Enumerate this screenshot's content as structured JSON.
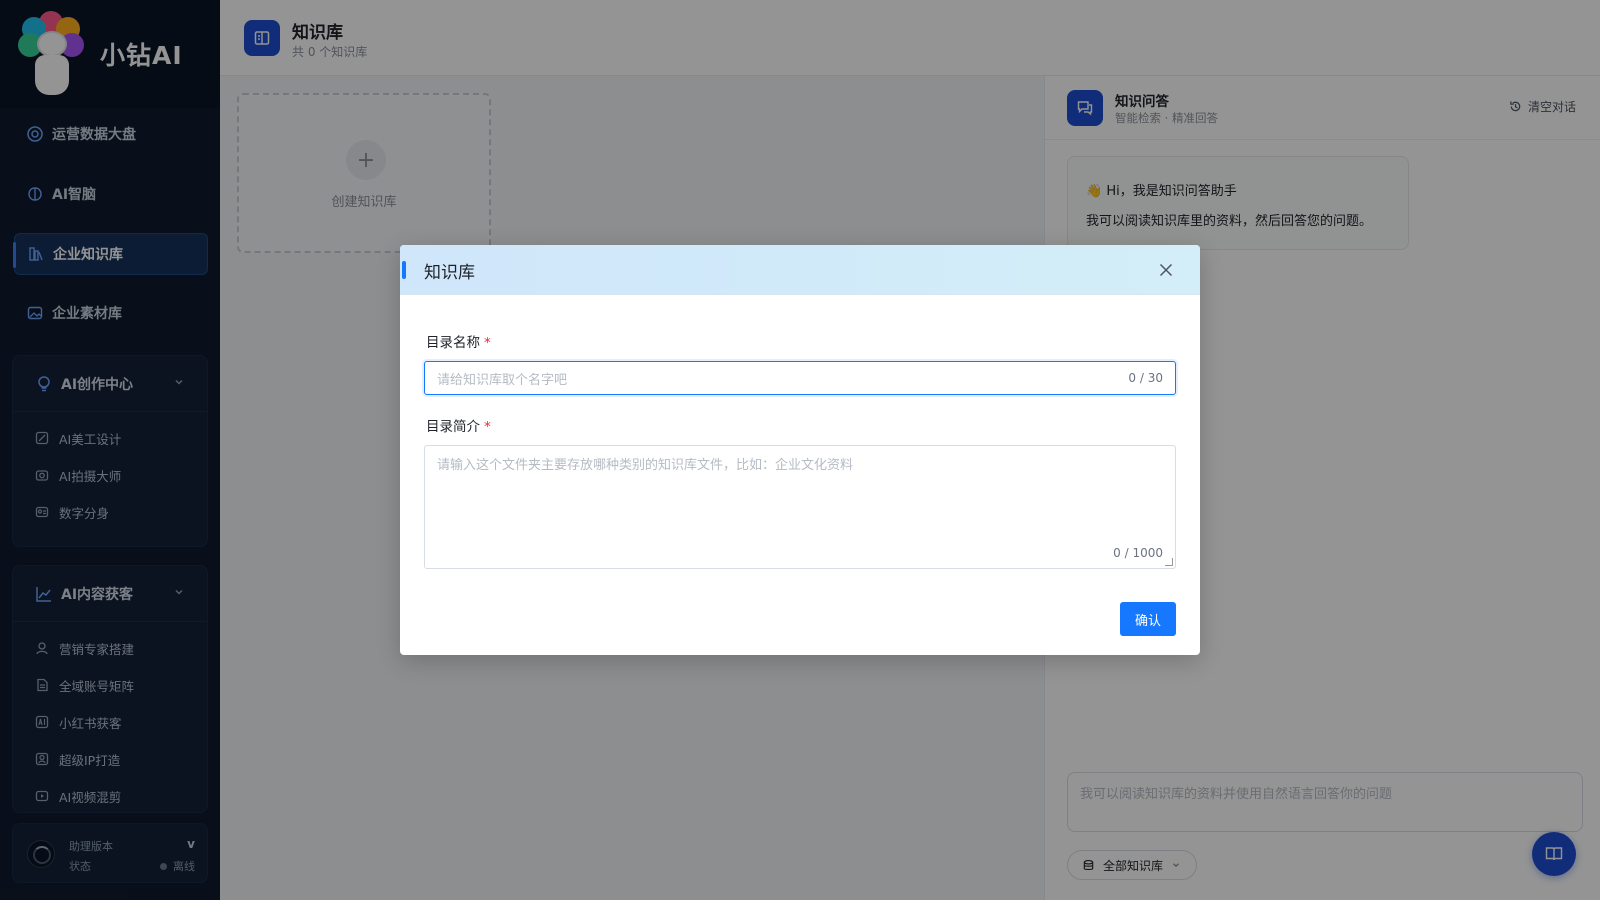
{
  "brand": {
    "name": "小钻AI",
    "badge": "小钻AI"
  },
  "sidebar": {
    "items": [
      {
        "label": "运营数据大盘",
        "icon": "dashboard-icon"
      },
      {
        "label": "AI智脑",
        "icon": "brain-icon"
      },
      {
        "label": "企业知识库",
        "icon": "library-icon",
        "active": true
      },
      {
        "label": "企业素材库",
        "icon": "image-icon"
      }
    ],
    "groups": [
      {
        "title": "AI创作中心",
        "icon": "bulb-icon",
        "items": [
          {
            "label": "AI美工设计"
          },
          {
            "label": "AI拍摄大师"
          },
          {
            "label": "数字分身"
          }
        ]
      },
      {
        "title": "AI内容获客",
        "icon": "trend-icon",
        "items": [
          {
            "label": "营销专家搭建"
          },
          {
            "label": "全域账号矩阵"
          },
          {
            "label": "小红书获客"
          },
          {
            "label": "超级IP打造"
          },
          {
            "label": "AI视频混剪"
          }
        ]
      }
    ],
    "version": {
      "label": "助理版本",
      "value": "v",
      "status_label": "状态",
      "status_value": "离线"
    }
  },
  "header": {
    "title": "知识库",
    "subtitle": "共 0 个知识库"
  },
  "create_card": {
    "label": "创建知识库",
    "plus": "+"
  },
  "chat": {
    "title": "知识问答",
    "subtitle": "智能检索 · 精准回答",
    "clear_label": "清空对话",
    "greeting": "👋 Hi，我是知识问答助手",
    "intro": "我可以阅读知识库里的资料，然后回答您的问题。",
    "input_placeholder": "我可以阅读知识库的资料并使用自然语言回答你的问题",
    "scope_label": "全部知识库"
  },
  "modal": {
    "title": "知识库",
    "name_label": "目录名称",
    "name_placeholder": "请给知识库取个名字吧",
    "name_count": "0 / 30",
    "desc_label": "目录简介",
    "desc_placeholder": "请输入这个文件夹主要存放哪种类别的知识库文件，比如：企业文化资料",
    "desc_count": "0 / 1000",
    "required_mark": "*",
    "confirm_label": "确认"
  },
  "colors": {
    "primary": "#1677ff",
    "sidebar_bg": "#0f1b2d",
    "accent": "#1e4fd1",
    "required": "#f5222d"
  }
}
